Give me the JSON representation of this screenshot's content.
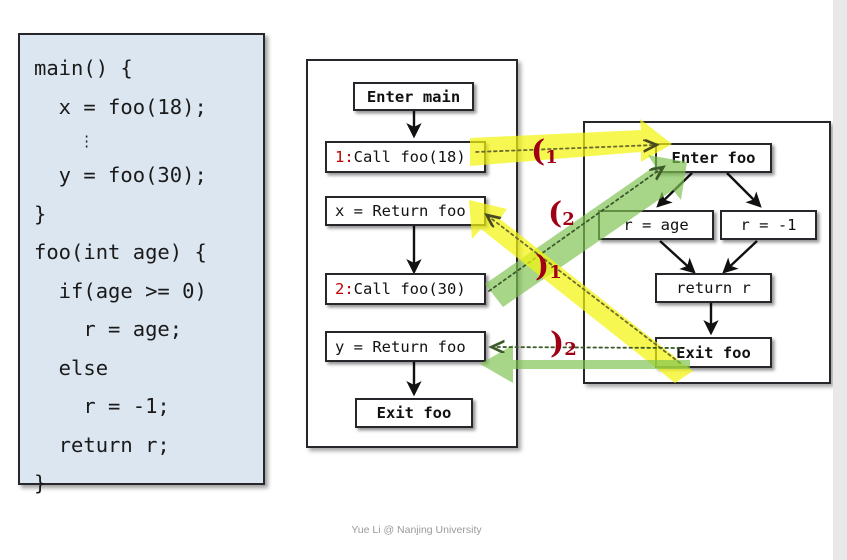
{
  "slide": {
    "footer": "Yue Li @ Nanjing University",
    "accent_red": "#c00000",
    "paren_red": "#a00014",
    "code_panel_fill": "#dce6f1",
    "band_yellow": "#f2f20d",
    "band_green": "#6fbf4a"
  },
  "code_panel": {
    "lines": [
      "main() {",
      "  x = foo(18);",
      "     ⋮",
      "  y = foo(30);",
      "}",
      "foo(int age) {",
      "  if(age >= 0)",
      "    r = age;",
      "  else",
      "    r = -1;",
      "  return r;",
      "}"
    ]
  },
  "cfg_main": {
    "nodes": [
      {
        "id": "enter-main",
        "label": "Enter main",
        "bold": true,
        "align": "center"
      },
      {
        "id": "call-foo-18",
        "prefix": "1:",
        "label": "Call foo(18)",
        "bold": false,
        "align": "left"
      },
      {
        "id": "x-return-foo",
        "label": "x = Return foo",
        "bold": false,
        "align": "left"
      },
      {
        "id": "call-foo-30",
        "prefix": "2:",
        "label": "Call foo(30)",
        "bold": false,
        "align": "left"
      },
      {
        "id": "y-return-foo",
        "label": "y = Return foo",
        "bold": false,
        "align": "left"
      },
      {
        "id": "exit-foo-main",
        "label": "Exit foo",
        "bold": true,
        "align": "center"
      }
    ]
  },
  "cfg_foo": {
    "nodes": [
      {
        "id": "enter-foo",
        "label": "Enter foo",
        "bold": true,
        "align": "center"
      },
      {
        "id": "r-age",
        "label": "r = age",
        "bold": false,
        "align": "center"
      },
      {
        "id": "r-minus-1",
        "label": "r = -1",
        "bold": false,
        "align": "center"
      },
      {
        "id": "return-r",
        "label": "return r",
        "bold": false,
        "align": "center"
      },
      {
        "id": "exit-foo",
        "label": "Exit foo",
        "bold": true,
        "align": "center"
      }
    ]
  },
  "context_labels": [
    {
      "id": "open-1",
      "bracket": "(",
      "sub": "1",
      "meaning": "call-edge-1-open"
    },
    {
      "id": "open-2",
      "bracket": "(",
      "sub": "2",
      "meaning": "call-edge-2-open"
    },
    {
      "id": "close-1",
      "bracket": ")",
      "sub": "1",
      "meaning": "return-edge-1-close"
    },
    {
      "id": "close-2",
      "bracket": ")",
      "sub": "2",
      "meaning": "return-edge-2-close"
    }
  ]
}
